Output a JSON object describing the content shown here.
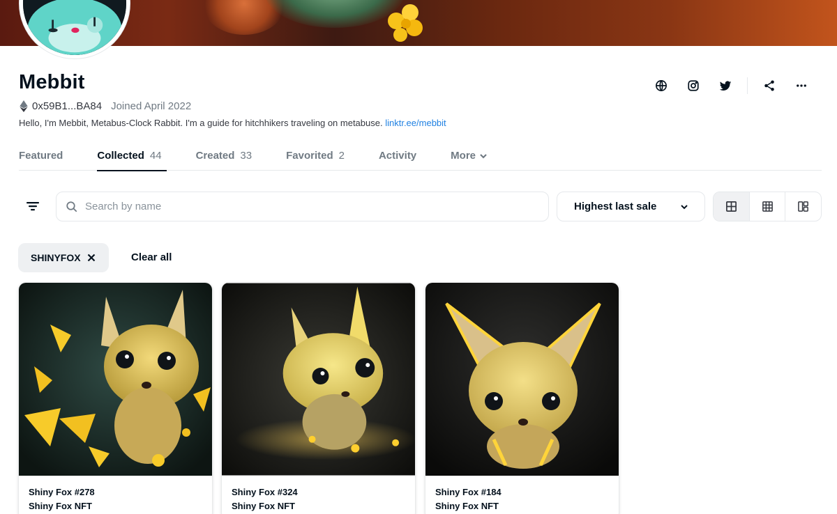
{
  "profile": {
    "name": "Mebbit",
    "address": "0x59B1...BA84",
    "joined": "Joined April 2022",
    "bio": "Hello, I'm Mebbit, Metabus-Clock Rabbit. I'm a guide for hitchhikers traveling on metabuse.",
    "bio_link": "linktr.ee/mebbit"
  },
  "socials": [
    "globe-icon",
    "instagram-icon",
    "twitter-icon",
    "share-icon",
    "more-icon"
  ],
  "tabs": [
    {
      "label": "Featured",
      "count": ""
    },
    {
      "label": "Collected",
      "count": "44"
    },
    {
      "label": "Created",
      "count": "33"
    },
    {
      "label": "Favorited",
      "count": "2"
    },
    {
      "label": "Activity",
      "count": ""
    },
    {
      "label": "More",
      "count": ""
    }
  ],
  "active_tab": "Collected",
  "search": {
    "placeholder": "Search by name",
    "value": ""
  },
  "sort": {
    "selected": "Highest last sale"
  },
  "view_modes": [
    "large-grid",
    "small-grid",
    "compact"
  ],
  "active_view": "large-grid",
  "filters": {
    "chips": [
      {
        "label": "SHINYFOX"
      }
    ],
    "clear_label": "Clear all"
  },
  "cards": [
    {
      "name": "Shiny Fox #278",
      "collection": "Shiny Fox NFT"
    },
    {
      "name": "Shiny Fox #324",
      "collection": "Shiny Fox NFT"
    },
    {
      "name": "Shiny Fox #184",
      "collection": "Shiny Fox NFT"
    }
  ],
  "colors": {
    "text_primary": "#04111d",
    "text_secondary": "#707a83",
    "link": "#2081e2",
    "border": "#e5e8eb",
    "chip_bg": "#eef0f2"
  }
}
